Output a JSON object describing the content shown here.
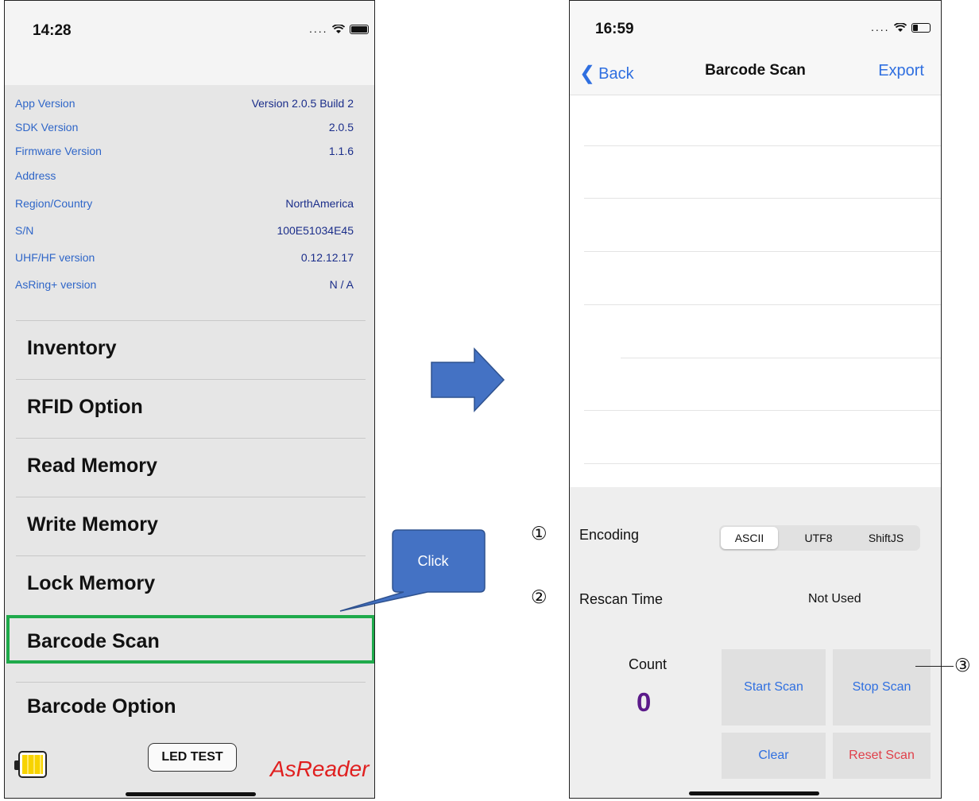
{
  "left_phone": {
    "status_time": "14:28",
    "info_rows": [
      {
        "label": "App Version",
        "value": "Version 2.0.5 Build 2"
      },
      {
        "label": "SDK Version",
        "value": "2.0.5"
      },
      {
        "label": "Firmware Version",
        "value": "1.1.6"
      },
      {
        "label": "Address",
        "value": ""
      },
      {
        "label": "Region/Country",
        "value": "NorthAmerica"
      },
      {
        "label": "S/N",
        "value": "100E51034E45"
      },
      {
        "label": "UHF/HF version",
        "value": "0.12.12.17"
      },
      {
        "label": "AsRing+ version",
        "value": "N / A"
      }
    ],
    "menu": [
      "Inventory",
      "RFID Option",
      "Read Memory",
      "Write Memory",
      "Lock Memory",
      "Barcode Scan",
      "Barcode Option"
    ],
    "led_test_label": "LED TEST",
    "brand": "AsReader"
  },
  "callout": {
    "text": "Click"
  },
  "right_phone": {
    "status_time": "16:59",
    "back_label": "Back",
    "title": "Barcode Scan",
    "export_label": "Export",
    "encoding": {
      "label": "Encoding",
      "options": [
        "ASCII",
        "UTF8",
        "ShiftJS"
      ],
      "selected": "ASCII"
    },
    "rescan": {
      "label": "Rescan Time",
      "value": "Not Used"
    },
    "count": {
      "label": "Count",
      "value": "0"
    },
    "buttons": {
      "start": "Start Scan",
      "stop": "Stop Scan",
      "clear": "Clear",
      "reset": "Reset Scan"
    }
  },
  "annotations": {
    "one": "①",
    "two": "②",
    "three": "③"
  },
  "colors": {
    "link_blue": "#2f6fe0",
    "info_label_blue": "#2f66c8",
    "highlight_green": "#1faa4b",
    "arrow_blue": "#4472c4",
    "count_purple": "#5b1a8a",
    "reset_red": "#e0404a",
    "brand_red": "#e02020"
  }
}
